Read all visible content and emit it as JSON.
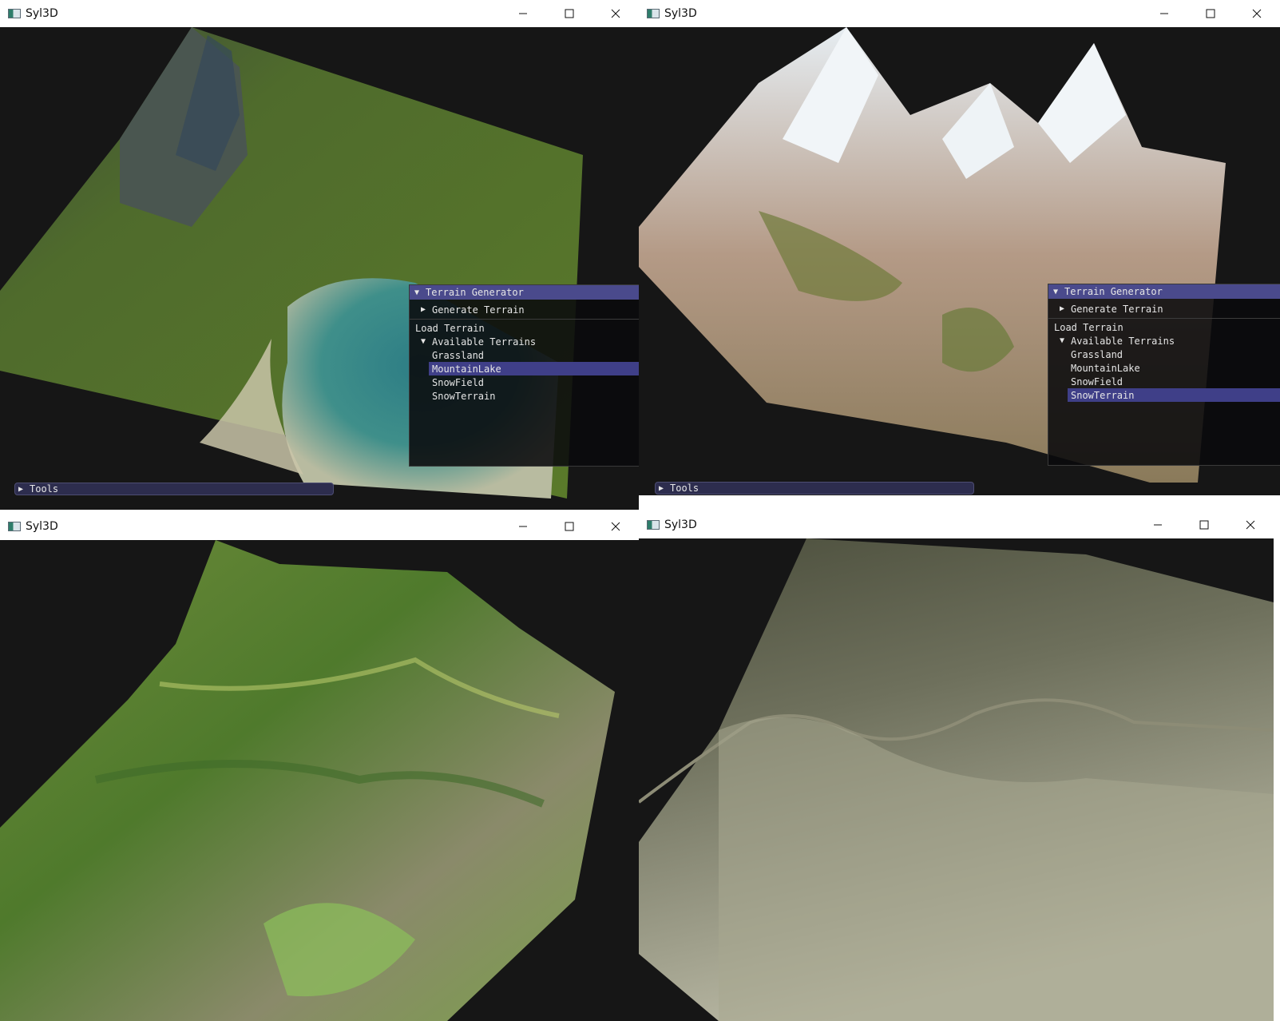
{
  "windows": [
    {
      "title": "Syl3D",
      "has_panel": true,
      "panel": {
        "header": "Terrain Generator",
        "generate": "Generate Terrain",
        "load": "Load Terrain",
        "available": "Available Terrains",
        "items": [
          "Grassland",
          "MountainLake",
          "SnowField",
          "SnowTerrain"
        ],
        "selected": "MountainLake"
      },
      "tools": "Tools"
    },
    {
      "title": "Syl3D",
      "has_panel": true,
      "panel": {
        "header": "Terrain Generator",
        "generate": "Generate Terrain",
        "load": "Load Terrain",
        "available": "Available Terrains",
        "items": [
          "Grassland",
          "MountainLake",
          "SnowField",
          "SnowTerrain"
        ],
        "selected": "SnowTerrain"
      },
      "tools": "Tools"
    },
    {
      "title": "Syl3D",
      "has_panel": false
    },
    {
      "title": "Syl3D",
      "has_panel": false
    }
  ],
  "icons": {
    "minimize": "minimize-icon",
    "maximize": "maximize-icon",
    "close": "close-icon",
    "app": "app-window-icon",
    "expand": "triangle-right-icon",
    "collapse": "triangle-down-icon"
  },
  "colors": {
    "titlebar": "#ffffff",
    "viewport": "#161616",
    "panel_header": "#4a4a8c",
    "selected": "#3f3f88"
  }
}
